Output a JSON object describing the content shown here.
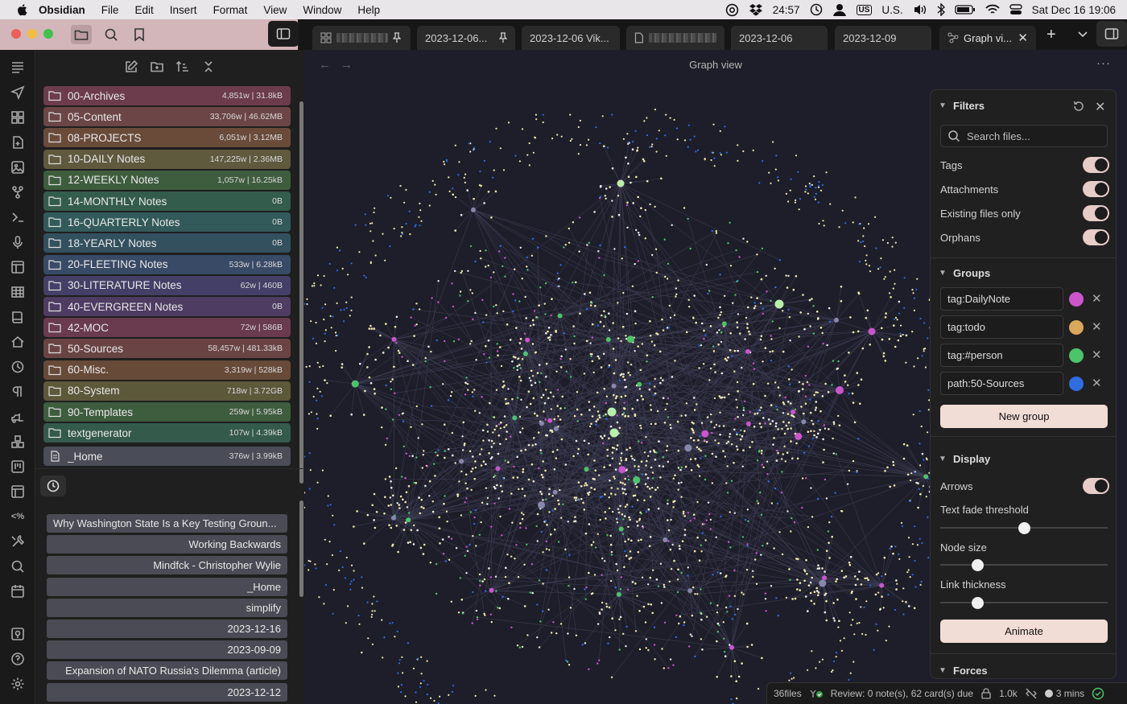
{
  "menubar": {
    "app_name": "Obsidian",
    "menus": [
      "File",
      "Edit",
      "Insert",
      "Format",
      "View",
      "Window",
      "Help"
    ],
    "timer": "24:57",
    "input_source": "U.S.",
    "datetime": "Sat Dec 16  19:06"
  },
  "tabs": [
    {
      "label": "2023-12-06...",
      "pinned": true
    },
    {
      "label": "2023-12-06 Vik..."
    },
    {
      "label": "2023-12-06"
    },
    {
      "label": "2023-12-09"
    },
    {
      "label": "Graph vi...",
      "active": true
    }
  ],
  "folders": [
    {
      "name": "00-Archives",
      "stat": "4,851w | 31.8kB",
      "color": "#6c3c4c"
    },
    {
      "name": "05-Content",
      "stat": "33,706w | 46.62MB",
      "color": "#6c4646"
    },
    {
      "name": "08-PROJECTS",
      "stat": "6,051w | 3.12MB",
      "color": "#6a4b3a"
    },
    {
      "name": "10-DAILY Notes",
      "stat": "147,225w | 2.36MB",
      "color": "#5f5a3e"
    },
    {
      "name": "12-WEEKLY Notes",
      "stat": "1,057w | 16.25kB",
      "color": "#3e5c3e"
    },
    {
      "name": "14-MONTHLY Notes",
      "stat": "0B",
      "color": "#345c4c"
    },
    {
      "name": "16-QUARTERLY Notes",
      "stat": "0B",
      "color": "#325a5a"
    },
    {
      "name": "18-YEARLY Notes",
      "stat": "0B",
      "color": "#32505e"
    },
    {
      "name": "20-FLEETING Notes",
      "stat": "533w | 6.28kB",
      "color": "#394a66"
    },
    {
      "name": "30-LITERATURE Notes",
      "stat": "62w | 460B",
      "color": "#433f66"
    },
    {
      "name": "40-EVERGREEN Notes",
      "stat": "0B",
      "color": "#4e3c62"
    },
    {
      "name": "42-MOC",
      "stat": "72w | 586B",
      "color": "#6a3a4e"
    },
    {
      "name": "50-Sources",
      "stat": "58,457w | 481.33kB",
      "color": "#6a4444"
    },
    {
      "name": "60-Misc.",
      "stat": "3,319w | 528kB",
      "color": "#674a38"
    },
    {
      "name": "80-System",
      "stat": "718w | 3.72GB",
      "color": "#5c583a"
    },
    {
      "name": "90-Templates",
      "stat": "259w | 5.95kB",
      "color": "#3e5c3e"
    },
    {
      "name": "textgenerator",
      "stat": "107w | 4.39kB",
      "color": "#345a4c"
    },
    {
      "name": "_Home",
      "stat": "376w | 3.99kB",
      "color": "#4a4c58",
      "is_file": true
    }
  ],
  "recent": [
    "Why Washington State Is a Key Testing Groun...",
    "Working Backwards",
    "Mindfck - Christopher Wylie",
    "_Home",
    "simplify",
    "2023-12-16",
    "2023-09-09",
    "Expansion of NATO Russia's Dilemma (article)",
    "2023-12-12"
  ],
  "graph": {
    "title": "Graph view"
  },
  "filters": {
    "title": "Filters",
    "search_placeholder": "Search files...",
    "options": [
      "Tags",
      "Attachments",
      "Existing files only",
      "Orphans"
    ],
    "groups_title": "Groups",
    "groups": [
      {
        "query": "tag:DailyNote",
        "color": "#cc55cc"
      },
      {
        "query": "tag:todo",
        "color": "#d9a85a"
      },
      {
        "query": "tag:#person",
        "color": "#4cc46a"
      },
      {
        "query": "path:50-Sources",
        "color": "#2f6de0"
      }
    ],
    "new_group": "New group",
    "display_title": "Display",
    "arrows": "Arrows",
    "text_fade": "Text fade threshold",
    "text_fade_value": 0.5,
    "node_size": "Node size",
    "node_size_value": 0.22,
    "link_thickness": "Link thickness",
    "link_thickness_value": 0.22,
    "animate": "Animate",
    "forces_title": "Forces"
  },
  "status": {
    "files": "36files",
    "review": "Review: 0 note(s), 62 card(s) due",
    "words": "1.0k",
    "time": "3 mins"
  }
}
